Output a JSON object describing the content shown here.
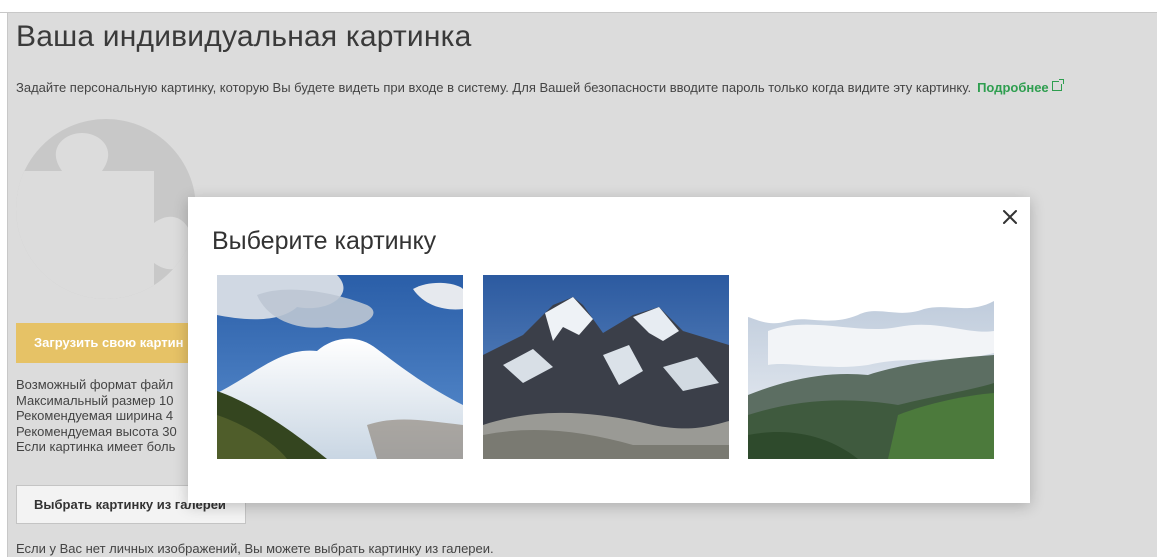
{
  "page": {
    "title": "Ваша индивидуальная картинка",
    "intro": "Задайте персональную картинку, которую Вы будете видеть при входе в систему. Для Вашей безопасности вводите пароль только когда видите эту картинку.",
    "more_link": "Подробнее",
    "more_link_icon": "external-link-icon"
  },
  "avatar": {
    "icon": "puzzle-piece-placeholder"
  },
  "upload": {
    "label": "Загрузить свою картин"
  },
  "requirements": [
    "Возможный формат файл",
    "Максимальный размер 10",
    "Рекомендуемая ширина 4",
    "Рекомендуемая высота 30",
    "Если картинка имеет боль"
  ],
  "gallery": {
    "button_label": "Выбрать картинку из галереи",
    "note": "Если у Вас нет личных изображений, Вы можете выбрать картинку из галереи."
  },
  "modal": {
    "title": "Выберите картинку",
    "close_icon": "close-icon",
    "images": [
      {
        "name": "snowy-twin-peaks"
      },
      {
        "name": "rocky-snow-mountain"
      },
      {
        "name": "green-valley-clouds"
      }
    ]
  },
  "colors": {
    "background": "#dcdcdc",
    "accent_link": "#2e9e4f",
    "upload_button": "#e6c266"
  }
}
